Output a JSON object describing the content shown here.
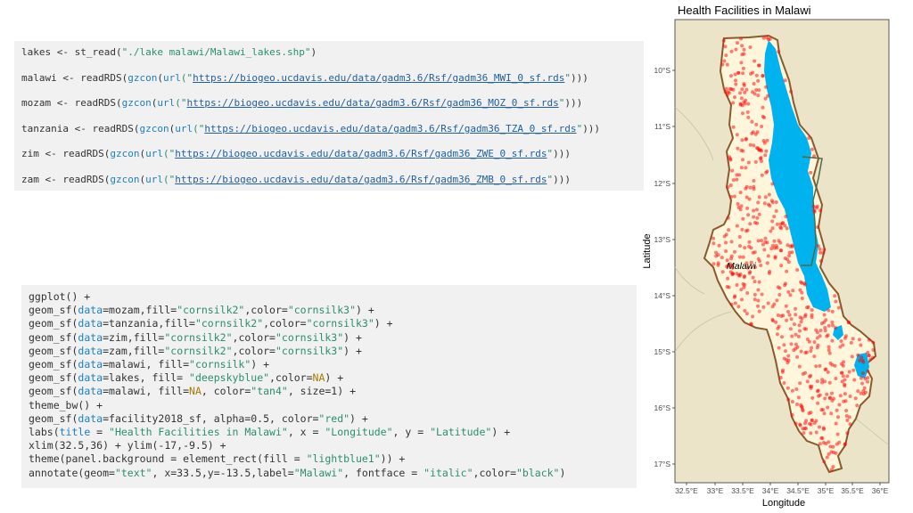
{
  "code_block_1": {
    "lines": [
      [
        {
          "t": "lakes <- st_read(",
          "c": ""
        },
        {
          "t": "\"./lake malawi/Malawi_lakes.shp\"",
          "c": "str"
        },
        {
          "t": ")",
          "c": ""
        }
      ],
      [
        {
          "t": "malawi <- readRDS(",
          "c": ""
        },
        {
          "t": "gzcon",
          "c": "fn"
        },
        {
          "t": "(",
          "c": ""
        },
        {
          "t": "url",
          "c": "fn"
        },
        {
          "t": "(\"",
          "c": "str"
        },
        {
          "t": "https://biogeo.ucdavis.edu/data/gadm3.6/Rsf/gadm36_MWI_0_sf.rds",
          "c": "url"
        },
        {
          "t": "\"",
          "c": "str"
        },
        {
          "t": ")))",
          "c": ""
        }
      ],
      [
        {
          "t": "mozam <- readRDS(",
          "c": ""
        },
        {
          "t": "gzcon",
          "c": "fn"
        },
        {
          "t": "(",
          "c": ""
        },
        {
          "t": "url",
          "c": "fn"
        },
        {
          "t": "(\"",
          "c": "str"
        },
        {
          "t": "https://biogeo.ucdavis.edu/data/gadm3.6/Rsf/gadm36_MOZ_0_sf.rds",
          "c": "url"
        },
        {
          "t": "\"",
          "c": "str"
        },
        {
          "t": ")))",
          "c": ""
        }
      ],
      [
        {
          "t": "tanzania <- readRDS(",
          "c": ""
        },
        {
          "t": "gzcon",
          "c": "fn"
        },
        {
          "t": "(",
          "c": ""
        },
        {
          "t": "url",
          "c": "fn"
        },
        {
          "t": "(\"",
          "c": "str"
        },
        {
          "t": "https://biogeo.ucdavis.edu/data/gadm3.6/Rsf/gadm36_TZA_0_sf.rds",
          "c": "url"
        },
        {
          "t": "\"",
          "c": "str"
        },
        {
          "t": ")))",
          "c": ""
        }
      ],
      [
        {
          "t": "zim <- readRDS(",
          "c": ""
        },
        {
          "t": "gzcon",
          "c": "fn"
        },
        {
          "t": "(",
          "c": ""
        },
        {
          "t": "url",
          "c": "fn"
        },
        {
          "t": "(\"",
          "c": "str"
        },
        {
          "t": "https://biogeo.ucdavis.edu/data/gadm3.6/Rsf/gadm36_ZWE_0_sf.rds",
          "c": "url"
        },
        {
          "t": "\"",
          "c": "str"
        },
        {
          "t": ")))",
          "c": ""
        }
      ],
      [
        {
          "t": "zam <- readRDS(",
          "c": ""
        },
        {
          "t": "gzcon",
          "c": "fn"
        },
        {
          "t": "(",
          "c": ""
        },
        {
          "t": "url",
          "c": "fn"
        },
        {
          "t": "(\"",
          "c": "str"
        },
        {
          "t": "https://biogeo.ucdavis.edu/data/gadm3.6/Rsf/gadm36_ZMB_0_sf.rds",
          "c": "url"
        },
        {
          "t": "\"",
          "c": "str"
        },
        {
          "t": ")))",
          "c": ""
        }
      ]
    ]
  },
  "code_block_2": {
    "lines": [
      [
        {
          "t": "ggplot() +",
          "c": ""
        }
      ],
      [
        {
          "t": "geom_sf(",
          "c": ""
        },
        {
          "t": "data",
          "c": "fn"
        },
        {
          "t": "=mozam,fill=",
          "c": ""
        },
        {
          "t": "\"cornsilk2\"",
          "c": "str"
        },
        {
          "t": ",color=",
          "c": ""
        },
        {
          "t": "\"cornsilk3\"",
          "c": "str"
        },
        {
          "t": ") +",
          "c": ""
        }
      ],
      [
        {
          "t": "geom_sf(",
          "c": ""
        },
        {
          "t": "data",
          "c": "fn"
        },
        {
          "t": "=tanzania,fill=",
          "c": ""
        },
        {
          "t": "\"cornsilk2\"",
          "c": "str"
        },
        {
          "t": ",color=",
          "c": ""
        },
        {
          "t": "\"cornsilk3\"",
          "c": "str"
        },
        {
          "t": ") +",
          "c": ""
        }
      ],
      [
        {
          "t": "geom_sf(",
          "c": ""
        },
        {
          "t": "data",
          "c": "fn"
        },
        {
          "t": "=zim,fill=",
          "c": ""
        },
        {
          "t": "\"cornsilk2\"",
          "c": "str"
        },
        {
          "t": ",color=",
          "c": ""
        },
        {
          "t": "\"cornsilk3\"",
          "c": "str"
        },
        {
          "t": ") +",
          "c": ""
        }
      ],
      [
        {
          "t": "geom_sf(",
          "c": ""
        },
        {
          "t": "data",
          "c": "fn"
        },
        {
          "t": "=zam,fill=",
          "c": ""
        },
        {
          "t": "\"cornsilk2\"",
          "c": "str"
        },
        {
          "t": ",color=",
          "c": ""
        },
        {
          "t": "\"cornsilk3\"",
          "c": "str"
        },
        {
          "t": ") +",
          "c": ""
        }
      ],
      [
        {
          "t": "geom_sf(",
          "c": ""
        },
        {
          "t": "data",
          "c": "fn"
        },
        {
          "t": "=malawi, fill=",
          "c": ""
        },
        {
          "t": "\"cornsilk\"",
          "c": "str"
        },
        {
          "t": ") +",
          "c": ""
        }
      ],
      [
        {
          "t": "geom_sf(",
          "c": ""
        },
        {
          "t": "data",
          "c": "fn"
        },
        {
          "t": "=lakes, fill= ",
          "c": ""
        },
        {
          "t": "\"deepskyblue\"",
          "c": "str"
        },
        {
          "t": ",color=",
          "c": ""
        },
        {
          "t": "NA",
          "c": "kw"
        },
        {
          "t": ") +",
          "c": ""
        }
      ],
      [
        {
          "t": "geom_sf(",
          "c": ""
        },
        {
          "t": "data",
          "c": "fn"
        },
        {
          "t": "=malawi, fill=",
          "c": ""
        },
        {
          "t": "NA",
          "c": "kw"
        },
        {
          "t": ", color=",
          "c": ""
        },
        {
          "t": "\"tan4\"",
          "c": "str"
        },
        {
          "t": ", size=1) +",
          "c": ""
        }
      ],
      [
        {
          "t": "theme_bw() +",
          "c": ""
        }
      ],
      [
        {
          "t": "geom_sf(",
          "c": ""
        },
        {
          "t": "data",
          "c": "fn"
        },
        {
          "t": "=facility2018_sf, alpha=0.5, color=",
          "c": ""
        },
        {
          "t": "\"red\"",
          "c": "str"
        },
        {
          "t": ") +",
          "c": ""
        }
      ],
      [
        {
          "t": "labs(",
          "c": ""
        },
        {
          "t": "title",
          "c": "fn"
        },
        {
          "t": " = ",
          "c": ""
        },
        {
          "t": "\"Health Facilities in Malawi\"",
          "c": "str"
        },
        {
          "t": ", x = ",
          "c": ""
        },
        {
          "t": "\"Longitude\"",
          "c": "str"
        },
        {
          "t": ", y = ",
          "c": ""
        },
        {
          "t": "\"Latitude\"",
          "c": "str"
        },
        {
          "t": ") +",
          "c": ""
        }
      ],
      [
        {
          "t": "xlim(32.5,36) + ylim(-17,-9.5) +",
          "c": ""
        }
      ],
      [
        {
          "t": "theme(panel.background = element_rect(fill = ",
          "c": ""
        },
        {
          "t": "\"lightblue1\"",
          "c": "str"
        },
        {
          "t": ")) +",
          "c": ""
        }
      ],
      [
        {
          "t": "annotate(geom=",
          "c": ""
        },
        {
          "t": "\"text\"",
          "c": "str"
        },
        {
          "t": ", x=33.5,y=-13.5,label=",
          "c": ""
        },
        {
          "t": "\"Malawi\"",
          "c": "str"
        },
        {
          "t": ", fontface = ",
          "c": ""
        },
        {
          "t": "\"italic\"",
          "c": "str"
        },
        {
          "t": ",color=",
          "c": ""
        },
        {
          "t": "\"black\"",
          "c": "str"
        },
        {
          "t": ")",
          "c": ""
        }
      ]
    ]
  },
  "map": {
    "title": "Health Facilities in Malawi",
    "xlabel": "Longitude",
    "ylabel": "Latitude",
    "x_ticks": [
      "32.5°E",
      "33°E",
      "33.5°E",
      "34°E",
      "34.5°E",
      "35°E",
      "35.5°E",
      "36°E"
    ],
    "y_ticks": [
      "10°S",
      "11°S",
      "12°S",
      "13°S",
      "14°S",
      "15°S",
      "16°S",
      "17°S"
    ],
    "annotation": "Malawi",
    "colors": {
      "background": "#ebe4c8",
      "malawi_fill": "#fff6dc",
      "border": "#8b5a2b",
      "lake": "#00b2ee",
      "points": "#ff0000"
    }
  },
  "chart_data": {
    "type": "scatter",
    "title": "Health Facilities in Malawi",
    "xlabel": "Longitude",
    "ylabel": "Latitude",
    "xlim": [
      32.5,
      36
    ],
    "ylim": [
      -17,
      -9.5
    ],
    "grid": false
  }
}
